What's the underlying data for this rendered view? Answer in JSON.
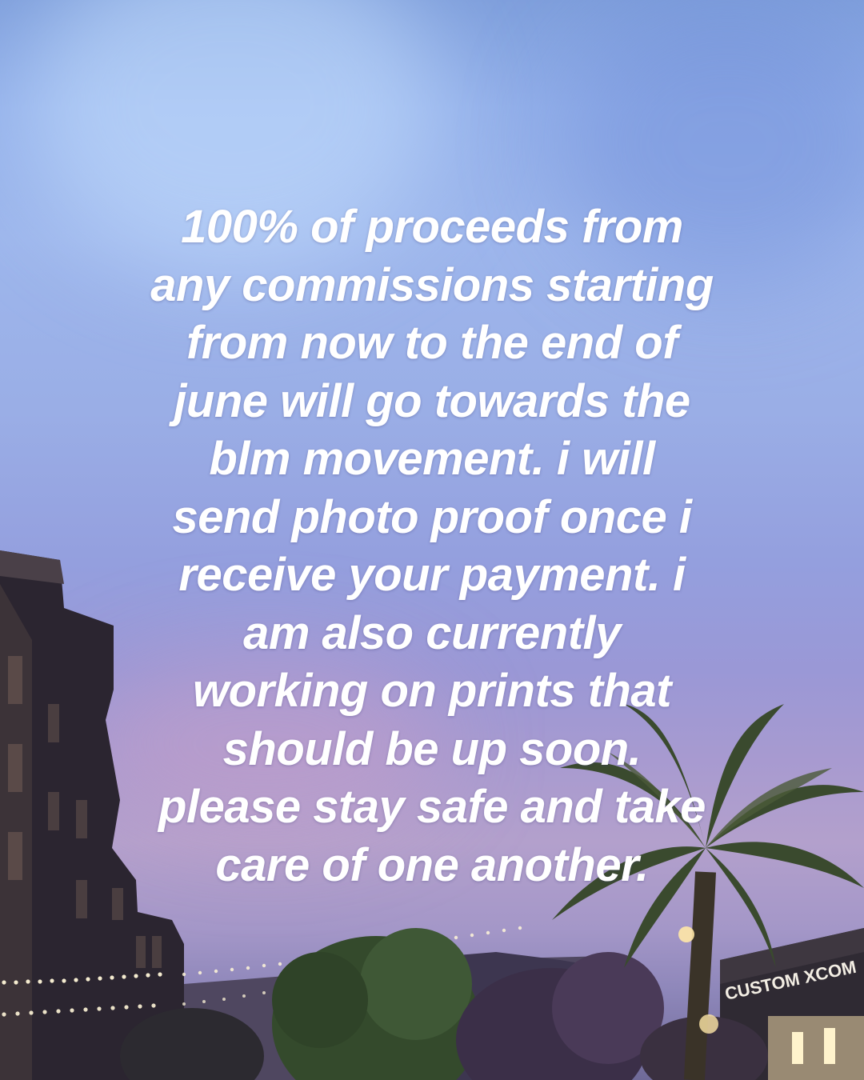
{
  "post": {
    "message_lines": [
      "100% of proceeds from",
      "any commissions starting",
      "from now to the end of",
      "june will go towards the",
      "blm movement. i will",
      "send photo proof once i",
      "receive your payment. i",
      "am also currently",
      "working on prints that",
      "should be up soon.",
      "please stay safe and take",
      "care of one another."
    ],
    "storefront_sign": "CUSTOM XCOM"
  },
  "colors": {
    "text": "#ffffff",
    "sky_top": "#7f9fdc",
    "sky_bottom_pink": "#b3a0cc"
  }
}
